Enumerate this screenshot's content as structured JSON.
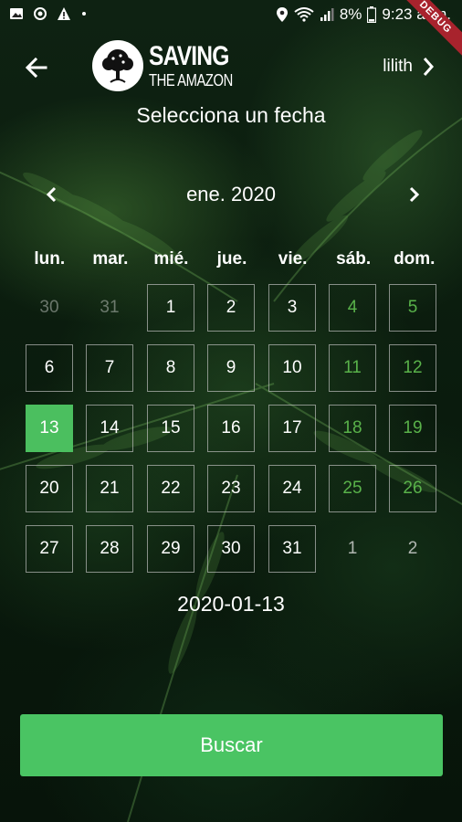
{
  "status_bar": {
    "battery": "8%",
    "time": "9:23 a. m.",
    "debug_banner": "DEBUG"
  },
  "header": {
    "logo_line1": "SAVING",
    "logo_line2": "THE AMAZON",
    "user_name": "lilith"
  },
  "title": "Selecciona un fecha",
  "calendar": {
    "month_label": "ene. 2020",
    "weekdays": [
      "lun.",
      "mar.",
      "mié.",
      "jue.",
      "vie.",
      "sáb.",
      "dom."
    ],
    "weeks": [
      [
        "30",
        "31",
        "1",
        "2",
        "3",
        "4",
        "5"
      ],
      [
        "6",
        "7",
        "8",
        "9",
        "10",
        "11",
        "12"
      ],
      [
        "13",
        "14",
        "15",
        "16",
        "17",
        "18",
        "19"
      ],
      [
        "20",
        "21",
        "22",
        "23",
        "24",
        "25",
        "26"
      ],
      [
        "27",
        "28",
        "29",
        "30",
        "31",
        "1",
        "2"
      ]
    ],
    "selected_day": "13"
  },
  "selected_date": "2020-01-13",
  "search_button": "Buscar",
  "colors": {
    "accent": "#4ac463",
    "weekend": "#59b24a"
  }
}
